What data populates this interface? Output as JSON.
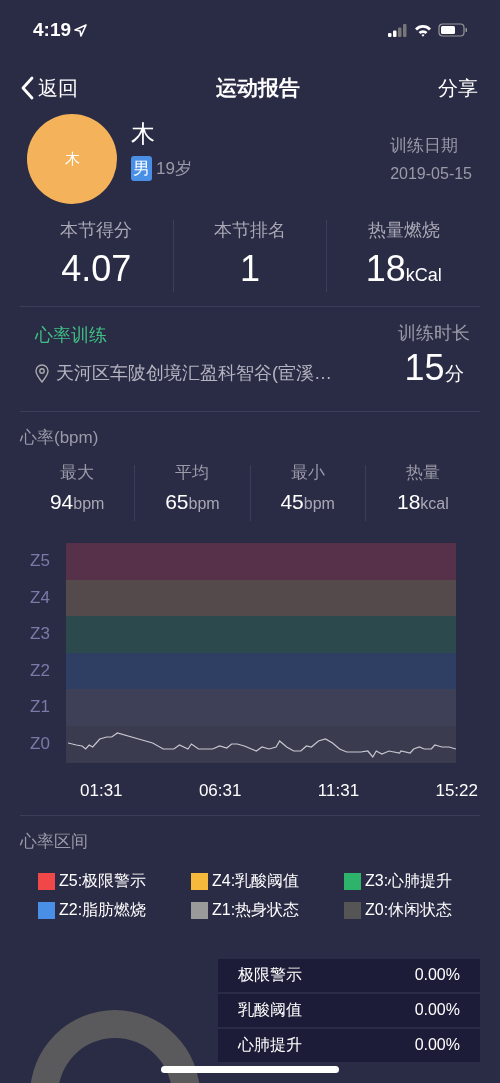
{
  "status_bar": {
    "time": "4:19"
  },
  "nav": {
    "back": "返回",
    "title": "运动报告",
    "share": "分享"
  },
  "profile": {
    "avatar_text": "木",
    "name": "木",
    "gender": "男",
    "age": "19岁",
    "date_label": "训练日期",
    "date": "2019-05-15"
  },
  "summary": [
    {
      "label": "本节得分",
      "value": "4.07"
    },
    {
      "label": "本节排名",
      "value": "1"
    },
    {
      "label": "热量燃烧",
      "value": "18",
      "unit": "kCal"
    }
  ],
  "session": {
    "type": "心率训练",
    "location": "天河区车陂创境汇盈科智谷(宦溪…",
    "duration_label": "训练时长",
    "duration": "15",
    "duration_unit": "分"
  },
  "heart_rate": {
    "title": "心率(bpm)",
    "stats": [
      {
        "label": "最大",
        "value": "94",
        "unit": "bpm"
      },
      {
        "label": "平均",
        "value": "65",
        "unit": "bpm"
      },
      {
        "label": "最小",
        "value": "45",
        "unit": "bpm"
      },
      {
        "label": "热量",
        "value": "18",
        "unit": "kcal"
      }
    ],
    "bands": [
      {
        "label": "Z5",
        "color": "#573149"
      },
      {
        "label": "Z4",
        "color": "#544a4c"
      },
      {
        "label": "Z3",
        "color": "#2c4a4e"
      },
      {
        "label": "Z2",
        "color": "#2e3f63"
      },
      {
        "label": "Z1",
        "color": "#3e4057"
      },
      {
        "label": "Z0",
        "color": "#3a3b4f"
      }
    ],
    "times": [
      "01:31",
      "06:31",
      "11:31",
      "15:22"
    ]
  },
  "zones": {
    "title": "心率区间",
    "legend": [
      {
        "label": "Z5:极限警示",
        "color": "#f04848"
      },
      {
        "label": "Z4:乳酸阈值",
        "color": "#f7b93c"
      },
      {
        "label": "Z3:心肺提升",
        "color": "#2eb36a"
      },
      {
        "label": "Z2:脂肪燃烧",
        "color": "#4a8fe6"
      },
      {
        "label": "Z1:热身状态",
        "color": "#9a9a9a"
      },
      {
        "label": "Z0:休闲状态",
        "color": "#555555"
      }
    ],
    "table": [
      {
        "name": "极限警示",
        "value": "0.00%"
      },
      {
        "name": "乳酸阈值",
        "value": "0.00%"
      },
      {
        "name": "心肺提升",
        "value": "0.00%"
      }
    ]
  }
}
